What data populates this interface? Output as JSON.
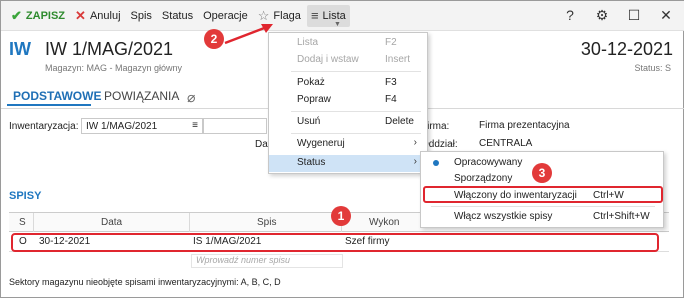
{
  "toolbar": {
    "save_label": "ZAPISZ",
    "cancel_label": "Anuluj",
    "spis_label": "Spis",
    "status_label": "Status",
    "operacje_label": "Operacje",
    "flaga_label": "Flaga",
    "lista_label": "Lista",
    "help_glyph": "?",
    "settings_glyph": "⚙",
    "maximize_glyph": "☐",
    "close_glyph": "✕"
  },
  "header": {
    "icon_text": "IW",
    "title": "IW 1/MAG/2021",
    "subtitle": "Magazyn: MAG - Magazyn główny",
    "date": "30-12-2021",
    "status": "Status: S"
  },
  "tabs": [
    {
      "label": "PODSTAWOWE",
      "active": true
    },
    {
      "label": "POWIĄZANIA",
      "active": false
    }
  ],
  "form": {
    "inwentaryzacja_label": "Inwentaryzacja:",
    "inwentaryzacja_value": "IW 1/MAG/2021",
    "dat_label": "Dat",
    "firma_label": "Firma:",
    "firma_value": "Firma prezentacyjna",
    "oddzial_label": "Oddział:",
    "oddzial_value": "CENTRALA"
  },
  "section": {
    "title": "SPISY"
  },
  "table": {
    "headers": [
      "S",
      "Data",
      "Spis",
      "Wykon"
    ],
    "rows": [
      {
        "s": "O",
        "data": "30-12-2021",
        "spis": "IS 1/MAG/2021",
        "wykon": "Szef firmy"
      }
    ],
    "add_placeholder": "Wprowadź numer spisu"
  },
  "footer_note": "Sektory magazynu nieobjęte spisami inwentaryzacyjnymi: A, B, C, D",
  "menu": {
    "items": [
      {
        "label": "Lista",
        "shortcut": "F2",
        "disabled": true
      },
      {
        "label": "Dodaj i wstaw",
        "shortcut": "Insert",
        "disabled": true
      },
      {
        "label": "Pokaż",
        "shortcut": "F3",
        "disabled": false
      },
      {
        "label": "Popraw",
        "shortcut": "F4",
        "disabled": false
      },
      {
        "label": "Usuń",
        "shortcut": "Delete",
        "disabled": false
      },
      {
        "label": "Wygeneruj",
        "shortcut": "",
        "disabled": false,
        "submenu": true
      },
      {
        "label": "Status",
        "shortcut": "",
        "disabled": false,
        "submenu": true,
        "active": true
      }
    ]
  },
  "submenu": {
    "items": [
      {
        "label": "Opracowywany",
        "shortcut": "",
        "selected": true
      },
      {
        "label": "Sporządzony",
        "shortcut": "",
        "selected": false
      },
      {
        "label": "Włączony do inwentaryzacji",
        "shortcut": "Ctrl+W",
        "selected": false,
        "highlighted": true
      },
      {
        "label": "Włącz wszystkie spisy",
        "shortcut": "Ctrl+Shift+W",
        "selected": false
      }
    ]
  },
  "badges": [
    "1",
    "2",
    "3"
  ],
  "colors": {
    "accent": "#1f77c0",
    "save_green": "#2e8b2e",
    "annotation_red": "#e0262f",
    "menu_active_bg": "#cfe3f6"
  }
}
